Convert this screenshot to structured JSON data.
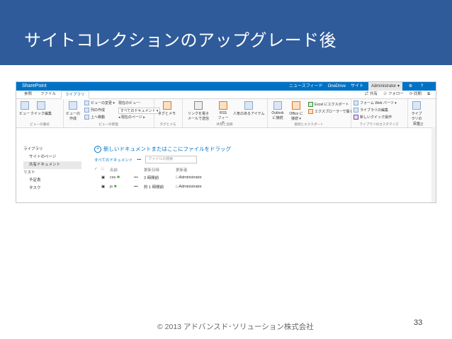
{
  "slide": {
    "title": "サイトコレクションのアップグレード後",
    "footer": "© 2013 アドバンスド･ソリューション株式会社",
    "page_number": "33"
  },
  "sp": {
    "brand": "SharePoint",
    "top_links": [
      "ニュースフィード",
      "OneDrive",
      "サイト"
    ],
    "admin": "Administrator ▾",
    "tabs": [
      "参照",
      "ファイル",
      "ライブラリ"
    ],
    "tab_right": [
      "共有",
      "フォロー",
      "同期"
    ],
    "ribbon_groups": [
      "ビューの書式",
      "ビューの管理",
      "タグとメモ",
      "共有と追跡",
      "接続とエクスポート",
      "ライブラリのカスタマイズ",
      "設定"
    ],
    "ribbon_buttons": {
      "view": "ビュー",
      "quick_edit": "クイック編集",
      "datasheet": "ビューの作成",
      "view_change": "ビューの変更 ▾",
      "current_view": "現在のビュー:",
      "create_column": "列の作成",
      "all_docs": "すべてのドキュメント ▾",
      "nav_up": "上へ移動",
      "current_page": "◂ 現在のページ ▸",
      "tags": "タグとメモ",
      "email_link": "リンクを電子メールで送信",
      "rss": "RSS フィード",
      "popular": "人気のあるアイテム",
      "outlook": "Outlook に接続",
      "office": "Office に接続 ▾",
      "excel_export": "Excel にエクスポート",
      "explorer": "エクスプローラーで開く",
      "form_web": "フォーム Web パーツ ▾",
      "lib_edit": "ライブラリの編集",
      "new_quick": "新しいクイック操作",
      "lib_settings": "ライブラリの設定"
    },
    "nav": {
      "library": "ライブラリ",
      "site_pages": "サイトのページ",
      "shared_docs": "共有ドキュメント",
      "list": "リスト",
      "calendar": "予定表",
      "tasks": "タスク"
    },
    "content": {
      "new_doc": "新しいドキュメントまたはここにファイルをドラッグ",
      "all_documents": "すべてのドキュメント",
      "ellipsis": "•••",
      "search_placeholder": "ファイルの検索",
      "headers": {
        "check": "✓",
        "type": "□",
        "name": "名前",
        "modified": "更新日時",
        "modified_by": "更新者"
      },
      "rows": [
        {
          "name": "css",
          "new": "✱",
          "menu": "•••",
          "modified": "3 時間前",
          "by": "□ Administrator"
        },
        {
          "name": "js",
          "new": "✱",
          "menu": "•••",
          "modified": "約 1 時間前",
          "by": "□ Administrator"
        }
      ]
    }
  },
  "colors": {
    "title_bg": "#2f5b9a",
    "sp_blue": "#0072c6"
  },
  "icons": [
    "cog-icon",
    "help-icon",
    "share-icon",
    "follow-icon",
    "sync-icon",
    "document-icon",
    "plus-icon",
    "search-icon"
  ]
}
